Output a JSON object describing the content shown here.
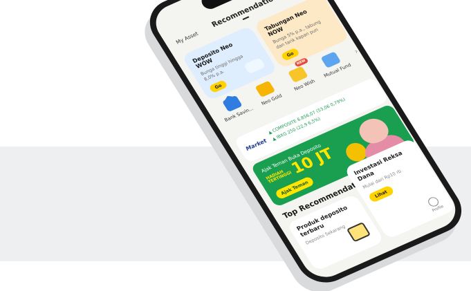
{
  "tabs": {
    "left": "My Asset",
    "active": "Recommendation"
  },
  "cards": {
    "deposito": {
      "title": "Deposito Neo WOW",
      "desc": "Bunga tinggi hingga 8,0% p.a.",
      "button": "Go"
    },
    "tabungan": {
      "title": "Tabungan Neo NOW",
      "desc": "Bunga 5% p.a., tabung dan tarik kapan pun",
      "button": "Go"
    }
  },
  "menu": [
    {
      "label": "Bank Savin...",
      "icon": "bank-icon"
    },
    {
      "label": "Neo Gold",
      "icon": "gold-icon"
    },
    {
      "label": "Neo Wish",
      "icon": "wish-icon",
      "badge": "NEW"
    },
    {
      "label": "Mutual Fund",
      "icon": "chart-icon"
    }
  ],
  "menu_chevron": "›",
  "market": {
    "label": "Market",
    "line1": "▲ COMPOSITE 6.856,07 (53,06 0,79%)",
    "line2": "▲ IBXG 250 (22,9 6,5%)"
  },
  "promo": {
    "text": "Ajak Teman Buka Deposito",
    "hadiah1": "HADIAH",
    "hadiah2": "TERTINGGI",
    "big": "10 JT",
    "button": "Ajak Teman"
  },
  "section": {
    "title": "Top Recommendation"
  },
  "small_cards": {
    "produk": {
      "title": "Produk deposito terbaru",
      "desc": "Deposito Sekarang"
    },
    "investasi": {
      "title": "Investasi Reksa Dana",
      "desc": "Mulai dari Rp10 rb",
      "button": "Lihat"
    }
  },
  "profile_tab": "Profile",
  "colors": {
    "accent": "#ffd200",
    "promo_green": "#1a9e50",
    "market_green": "#1f9e57"
  }
}
